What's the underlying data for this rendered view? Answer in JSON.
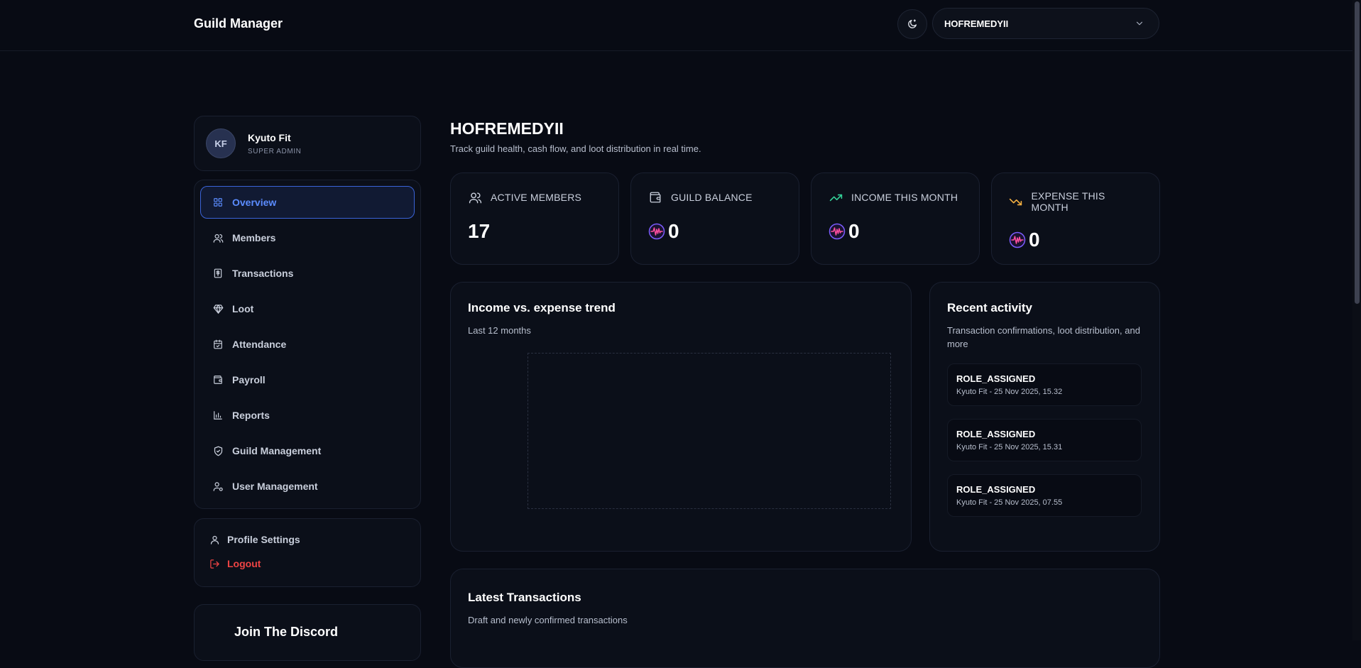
{
  "app": {
    "title": "Guild Manager"
  },
  "header": {
    "theme_icon": "moon-icon",
    "guild_selector": {
      "value": "HOFREMEDYII",
      "icon": "chevron-down-icon"
    }
  },
  "user": {
    "initials": "KF",
    "name": "Kyuto Fit",
    "role": "SUPER ADMIN"
  },
  "nav": {
    "items": [
      {
        "label": "Overview",
        "icon": "grid-icon",
        "active": true
      },
      {
        "label": "Members",
        "icon": "users-icon"
      },
      {
        "label": "Transactions",
        "icon": "receipt-icon"
      },
      {
        "label": "Loot",
        "icon": "diamond-icon"
      },
      {
        "label": "Attendance",
        "icon": "calendar-check-icon"
      },
      {
        "label": "Payroll",
        "icon": "wallet-icon"
      },
      {
        "label": "Reports",
        "icon": "bar-chart-icon"
      },
      {
        "label": "Guild Management",
        "icon": "shield-icon"
      },
      {
        "label": "User Management",
        "icon": "user-cog-icon"
      }
    ]
  },
  "account": {
    "profile_settings": "Profile Settings",
    "logout": "Logout"
  },
  "discord": {
    "title": "Join The Discord"
  },
  "page": {
    "title": "HOFREMEDYII",
    "subtitle": "Track guild health, cash flow, and loot distribution in real time."
  },
  "stats": [
    {
      "label": "ACTIVE MEMBERS",
      "value": "17",
      "icon": "users-icon",
      "coin": false
    },
    {
      "label": "GUILD BALANCE",
      "value": "0",
      "icon": "wallet-icon",
      "coin": true
    },
    {
      "label": "INCOME THIS MONTH",
      "value": "0",
      "icon": "trending-up-icon",
      "coin": true
    },
    {
      "label": "EXPENSE THIS MONTH",
      "value": "0",
      "icon": "trending-down-icon",
      "coin": true
    }
  ],
  "colors": {
    "accent": "#5b8cff",
    "income": "#34d399",
    "expense": "#f5b041",
    "logout": "#ef4444"
  },
  "trend": {
    "title": "Income vs. expense trend",
    "subtitle": "Last 12 months"
  },
  "activity": {
    "title": "Recent activity",
    "subtitle": "Transaction confirmations, loot distribution, and more",
    "items": [
      {
        "title": "ROLE_ASSIGNED",
        "meta": "Kyuto Fit - 25 Nov 2025, 15.32"
      },
      {
        "title": "ROLE_ASSIGNED",
        "meta": "Kyuto Fit - 25 Nov 2025, 15.31"
      },
      {
        "title": "ROLE_ASSIGNED",
        "meta": "Kyuto Fit - 25 Nov 2025, 07.55"
      }
    ]
  },
  "latest": {
    "title": "Latest Transactions",
    "subtitle": "Draft and newly confirmed transactions"
  }
}
